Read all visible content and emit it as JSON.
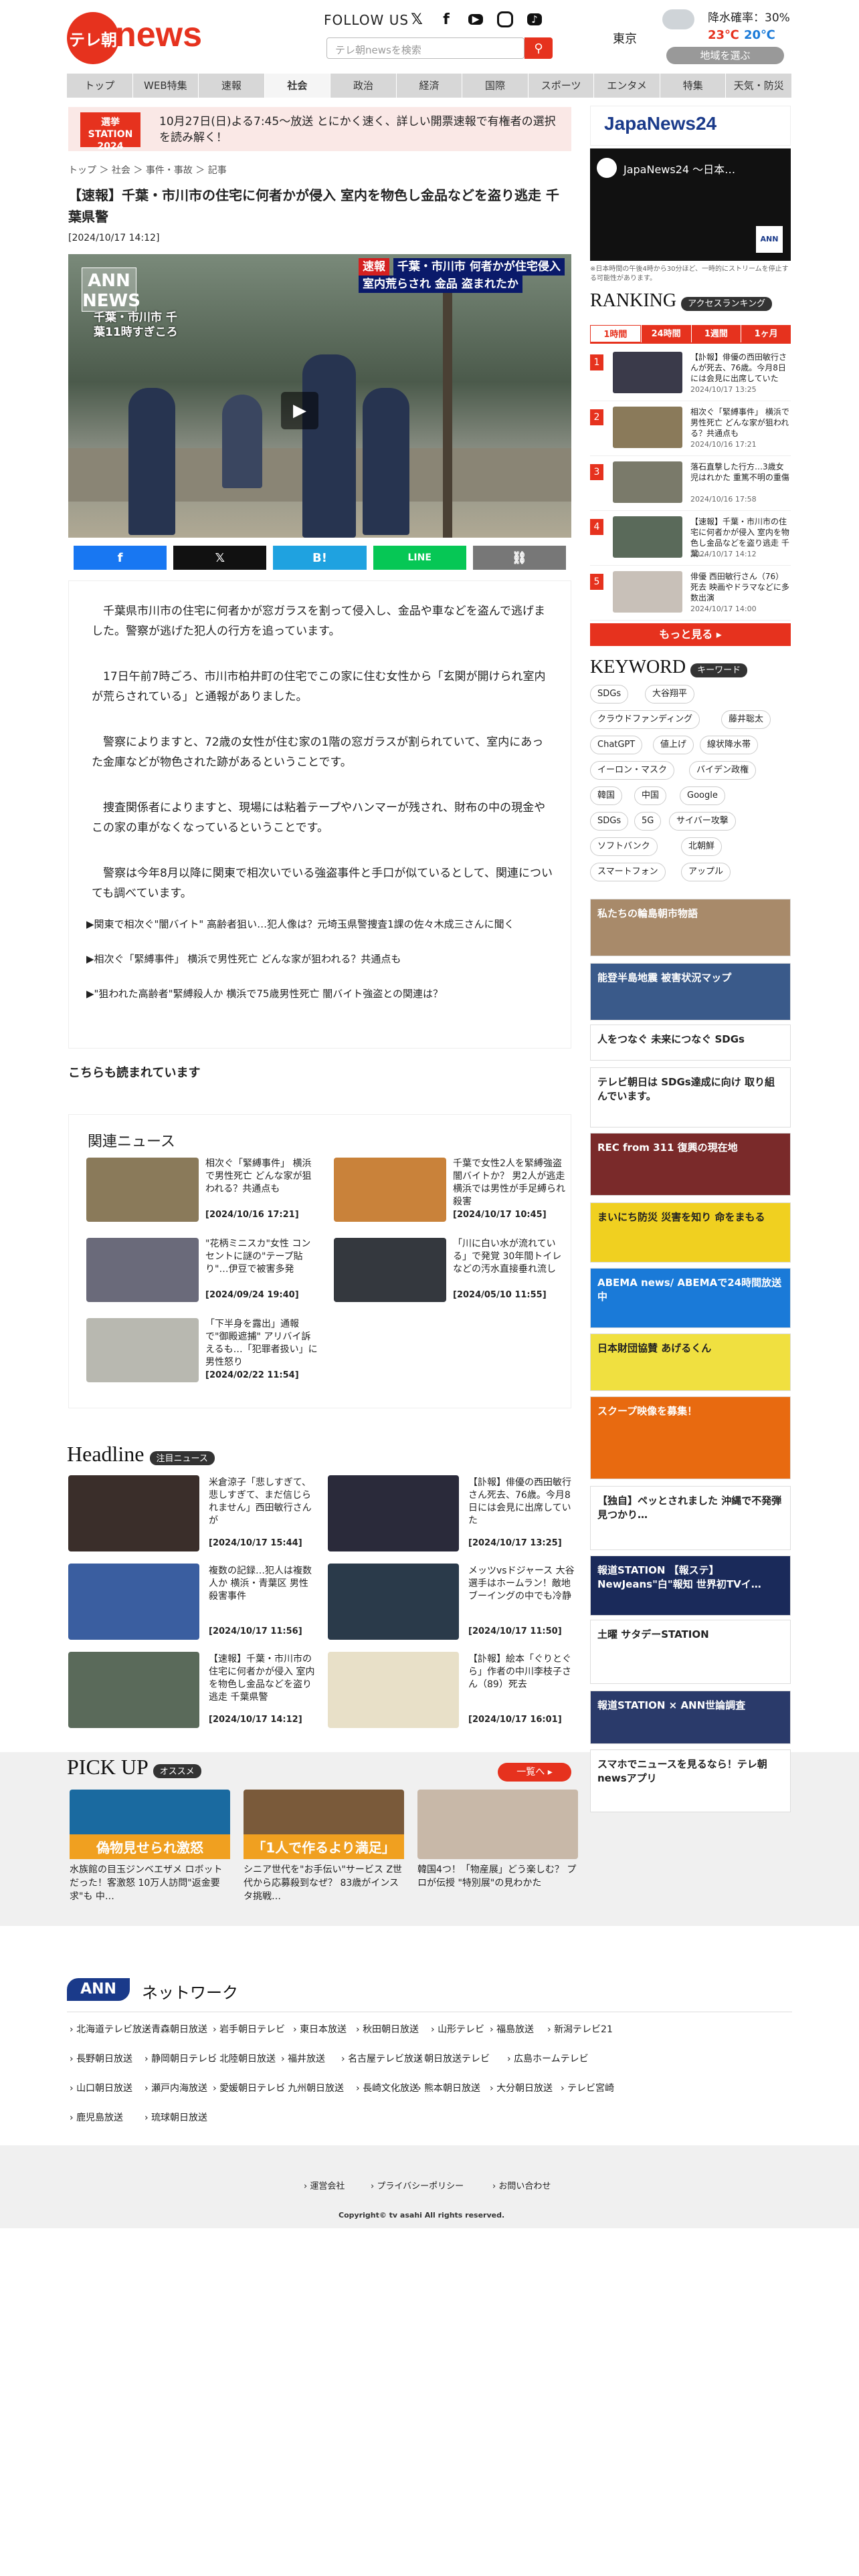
{
  "header": {
    "logo_badge": "テレ朝",
    "logo_text": "news",
    "follow_label": "FOLLOW US",
    "social_icons": [
      "x-icon",
      "facebook-icon",
      "youtube-icon",
      "instagram-icon",
      "tiktok-icon"
    ],
    "search_placeholder": "テレ朝newsを検索",
    "weather": {
      "city": "東京",
      "rain": "降水確率：30%",
      "high": "23℃",
      "low": "20℃",
      "choose_area": "地域を選ぶ"
    }
  },
  "nav": [
    "トップ",
    "WEB特集",
    "速報",
    "社会",
    "政治",
    "経済",
    "国際",
    "スポーツ",
    "エンタメ",
    "特集",
    "天気・防災"
  ],
  "nav_active_index": 3,
  "banner": {
    "badge": "選挙 STATION 2024",
    "text": "10月27日(日)よる7:45～放送 とにかく速く、詳しい開票速報で有権者の選択を読み解く！"
  },
  "breadcrumb": [
    "トップ",
    "社会",
    "事件・事故",
    "記事"
  ],
  "article": {
    "title": "【速報】千葉・市川市の住宅に何者かが侵入 室内を物色し金品などを盗り逃走 千葉県警",
    "date": "[2024/10/17 14:12]",
    "video_ann": "ANN NEWS",
    "video_caption_left": "千葉・市川市 千葉11時すぎころ",
    "video_caption_right_tag": "速報",
    "video_caption_right1": "千葉・市川市 何者かが住宅侵入",
    "video_caption_right2": "室内荒らされ 金品 盗まれたか",
    "paragraphs": [
      "千葉県市川市の住宅に何者かが窓ガラスを割って侵入し、金品や車などを盗んで逃げました。警察が逃げた犯人の行方を追っています。",
      "17日午前7時ごろ、市川市柏井町の住宅でこの家に住む女性から「玄関が開けられ室内が荒らされている」と通報がありました。",
      "警察によりますと、72歳の女性が住む家の1階の窓ガラスが割られていて、室内にあった金庫などが物色された跡があるということです。",
      "捜査関係者によりますと、現場には粘着テープやハンマーが残され、財布の中の現金やこの家の車がなくなっているということです。",
      "警察は今年8月以降に関東で相次いでいる強盗事件と手口が似ているとして、関連についても調べています。"
    ],
    "related_links": [
      "▶関東で相次ぐ\"闇バイト\" 高齢者狙い…犯人像は？元埼玉県警捜査1課の佐々木成三さんに聞く",
      "▶相次ぐ「緊縛事件」 横浜で男性死亡 どんな家が狙われる？共通点も",
      "▶\"狙われた高齢者\"緊縛殺人か 横浜で75歳男性死亡 闇バイト強盗との関連は？"
    ]
  },
  "also_read": "こちらも読まれています",
  "related_news": {
    "title": "関連ニュース",
    "items": [
      {
        "title": "相次ぐ「緊縛事件」 横浜で男性死亡 どんな家が狙われる？共通点も",
        "date": "[2024/10/16 17:21]",
        "color": "#8a7a5a"
      },
      {
        "title": "千葉で女性2人を緊縛強盗 闇バイトか？ 男2人が逃走 横浜では男性が手足縛られ殺害",
        "date": "[2024/10/17 10:45]",
        "color": "#c9823a"
      },
      {
        "title": "\"花柄ミニスカ\"女性 コンセントに謎の\"テープ貼り\"…伊豆で被害多発",
        "date": "[2024/09/24 19:40]",
        "color": "#6a6a7a"
      },
      {
        "title": "「川に白い水が流れている」で発覚 30年間トイレなどの汚水直接垂れ流し",
        "date": "[2024/05/10 11:55]",
        "color": "#34383e"
      },
      {
        "title": "「下半身を露出」通報で\"御殿遮捕\" アリバイ訴えるも…「犯罪者扱い」に男性怒り",
        "date": "[2024/02/22 11:54]",
        "color": "#b8b8b0"
      }
    ]
  },
  "headline": {
    "title": "Headline",
    "tag": "注目ニュース",
    "items": [
      {
        "title": "米倉涼子「悲しすぎて、悲しすぎて、まだ信じられません」西田敏行さんが",
        "date": "[2024/10/17 15:44]",
        "color": "#3a2e2a"
      },
      {
        "title": "【訃報】俳優の西田敏行さん死去、76歳。今月8日には会見に出席していた",
        "date": "[2024/10/17 13:25]",
        "color": "#2a2a3a"
      },
      {
        "title": "複数の記録…犯人は複数人か 横浜・青葉区 男性殺害事件",
        "date": "[2024/10/17 11:56]",
        "color": "#3a5ea0"
      },
      {
        "title": "メッツvsドジャース 大谷選手はホームラン！敵地ブーイングの中でも冷静",
        "date": "[2024/10/17 11:50]",
        "color": "#2a3a4a"
      },
      {
        "title": "【速報】千葉・市川市の住宅に何者かが侵入 室内を物色し金品などを盗り逃走 千葉県警",
        "date": "[2024/10/17 14:12]",
        "color": "#5a6a5a"
      },
      {
        "title": "【訃報】絵本「ぐりとぐら」作者の中川李枝子さん（89）死去",
        "date": "[2024/10/17 16:01]",
        "color": "#e8e0c8"
      }
    ]
  },
  "pickup": {
    "title": "PICK UP",
    "tag": "オススメ",
    "more": "一覧へ",
    "items": [
      {
        "title": "水族館の目玉ジンベエザメ ロボットだった！客激怒 10万人訪問\"返金要求\"も 中…",
        "caption": "偽物見せられ激怒",
        "color": "#1a6aa0"
      },
      {
        "title": "シニア世代を\"お手伝い\"サービス Z世代から応募殺到なぜ？ 83歳がインスタ挑戦…",
        "caption": "「1人で作るより満足」",
        "color": "#7a5a3a"
      },
      {
        "title": "韓国4つ！「物産展」どう楽しむ？ プロが伝授 \"特別展\"の見わかた",
        "caption": "",
        "color": "#c8b8a8"
      }
    ]
  },
  "sidebar": {
    "japannews_logo": "JapaNews24",
    "japannews_video_title": "JapaNews24 ～日本…",
    "japannews_note": "※日本時間の午後4時から30分ほど、一時的にストリームを停止する可能性があります。",
    "ranking_title": "RANKING",
    "ranking_tag": "アクセスランキング",
    "ranking_tabs": [
      "1時間",
      "24時間",
      "1週間",
      "1ヶ月"
    ],
    "ranking_tab_active": 0,
    "ranking": [
      {
        "rank": "1",
        "title": "【訃報】俳優の西田敏行さんが死去、76歳。今月8日には会見に出席していた",
        "date": "2024/10/17 13:25",
        "color": "#3a3a4a"
      },
      {
        "rank": "2",
        "title": "相次ぐ「緊縛事件」 横浜で男性死亡 どんな家が狙われる？共通点も",
        "date": "2024/10/16 17:21",
        "color": "#8a7a5a"
      },
      {
        "rank": "3",
        "title": "落石直撃した行方…3歳女児はれかた 重篤不明の重傷",
        "date": "2024/10/16 17:58",
        "color": "#7a7a6a"
      },
      {
        "rank": "4",
        "title": "【速報】千葉・市川市の住宅に何者かが侵入 室内を物色し金品などを盗り逃走 千葉…",
        "date": "2024/10/17 14:12",
        "color": "#5a6a5a"
      },
      {
        "rank": "5",
        "title": "俳優 西田敏行さん（76）死去 映画やドラマなどに多数出演",
        "date": "2024/10/17 14:00",
        "color": "#c8c0b8"
      }
    ],
    "ranking_more": "もっと見る",
    "keyword_title": "KEYWORD",
    "keyword_tag": "キーワード",
    "keywords": [
      "SDGs",
      "大谷翔平",
      "クラウドファンディング",
      "藤井聡太",
      "ChatGPT",
      "値上げ",
      "線状降水帯",
      "イーロン・マスク",
      "バイデン政権",
      "韓国",
      "中国",
      "Google",
      "SDGs",
      "5G",
      "サイバー攻撃",
      "ソフトバンク",
      "北朝鮮",
      "スマートフォン",
      "アップル"
    ],
    "banners": [
      {
        "text": "私たちの輪島朝市物語",
        "color": "#a88a6a"
      },
      {
        "text": "能登半島地震 被害状況マップ",
        "color": "#3a5a8a"
      },
      {
        "text": "人をつなぐ 未来につなぐ SDGs",
        "color": "#ffffff"
      },
      {
        "text": "テレビ朝日は SDGs達成に向け 取り組んでいます。",
        "color": "#ffffff"
      },
      {
        "text": "REC from 311 復興の現在地",
        "color": "#7a2a2a"
      },
      {
        "text": "まいにち防災 災害を知り 命をまもる",
        "color": "#f0d020"
      },
      {
        "text": "ABEMA news/ ABEMAで24時間放送中",
        "color": "#1a7ad8"
      },
      {
        "text": "日本財団協賛 あげるくん",
        "color": "#f0e040"
      },
      {
        "text": "スクープ映像を募集！",
        "color": "#e86a10"
      },
      {
        "text": "【独自】ペッとされました 沖縄で不発弾見つかり…",
        "color": "#ffffff"
      },
      {
        "text": "報道STATION 【報ステ】 NewJeans\"白\"報知 世界初TVイ…",
        "color": "#1a2a5a"
      },
      {
        "text": "土曜 サタデーSTATION",
        "color": "#ffffff"
      },
      {
        "text": "報道STATION × ANN世論調査",
        "color": "#2a3a6a"
      },
      {
        "text": "スマホでニュースを見るなら！テレ朝newsアプリ",
        "color": "#ffffff"
      }
    ]
  },
  "network": {
    "title": "ネットワーク",
    "stations": [
      "北海道テレビ放送",
      "青森朝日放送",
      "岩手朝日テレビ",
      "東日本放送",
      "秋田朝日放送",
      "山形テレビ",
      "福島放送",
      "新潟テレビ21",
      "長野朝日放送",
      "静岡朝日テレビ",
      "北陸朝日放送",
      "福井放送",
      "名古屋テレビ放送",
      "朝日放送テレビ",
      "広島ホームテレビ",
      "山口朝日放送",
      "瀬戸内海放送",
      "愛媛朝日テレビ",
      "九州朝日放送",
      "長崎文化放送",
      "熊本朝日放送",
      "大分朝日放送",
      "テレビ宮崎",
      "鹿児島放送",
      "琉球朝日放送"
    ]
  },
  "footer": {
    "links": [
      "運営会社",
      "プライバシーポリシー",
      "お問い合わせ"
    ],
    "copyright": "Copyright© tv asahi All rights reserved."
  }
}
